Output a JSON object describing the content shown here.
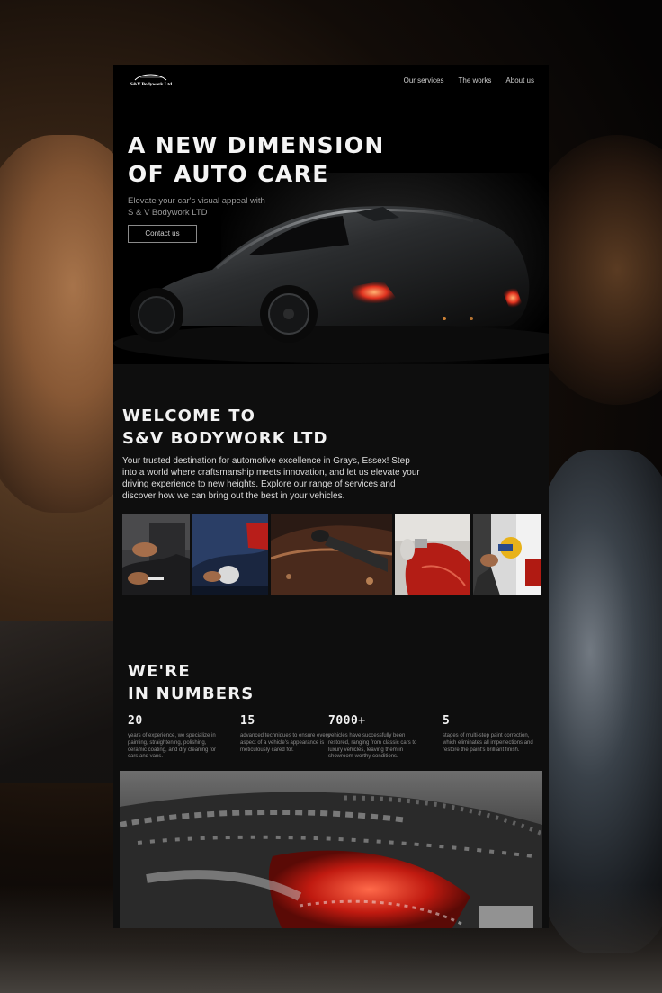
{
  "brand": {
    "logo_text": "S&V Bodywork Ltd"
  },
  "nav": {
    "items": [
      "Our services",
      "The works",
      "About us"
    ]
  },
  "hero": {
    "title_line1": "A NEW DIMENSION",
    "title_line2": "OF AUTO CARE",
    "subtitle": "Elevate your car's visual appeal with S & V Bodywork LTD",
    "cta_label": "Contact us"
  },
  "welcome": {
    "title_line1": "WELCOME TO",
    "title_line2": "S&V BODYWORK LTD",
    "body": "Your trusted destination for automotive excellence in Grays, Essex! Step into a world where craftsmanship meets innovation, and let us elevate your driving experience to new heights. Explore our range of services and discover how we can bring out the best in your vehicles."
  },
  "numbers": {
    "title_line1": "WE'RE",
    "title_line2": "IN NUMBERS",
    "stats": [
      {
        "value": "20",
        "desc": "years of experience, we specialize in painting, straightening, polishing, ceramic coating, and dry cleaning for cars and vans."
      },
      {
        "value": "15",
        "desc": "advanced techniques to ensure every aspect of a vehicle's appearance is meticulously cared for."
      },
      {
        "value": "7000+",
        "desc": "vehicles have successfully been restored, ranging from classic cars to luxury vehicles, leaving them in showroom-worthy conditions."
      },
      {
        "value": "5",
        "desc": "stages of multi-step paint correction, which eliminates all imperfections and restore the paint's brilliant finish."
      }
    ]
  },
  "colors": {
    "page_bg": "#0e0e0e",
    "accent_red": "#e0321f",
    "text_primary": "#f2f2f2",
    "text_muted": "#8c8c8c"
  },
  "icons": [
    "car-logo-icon"
  ]
}
